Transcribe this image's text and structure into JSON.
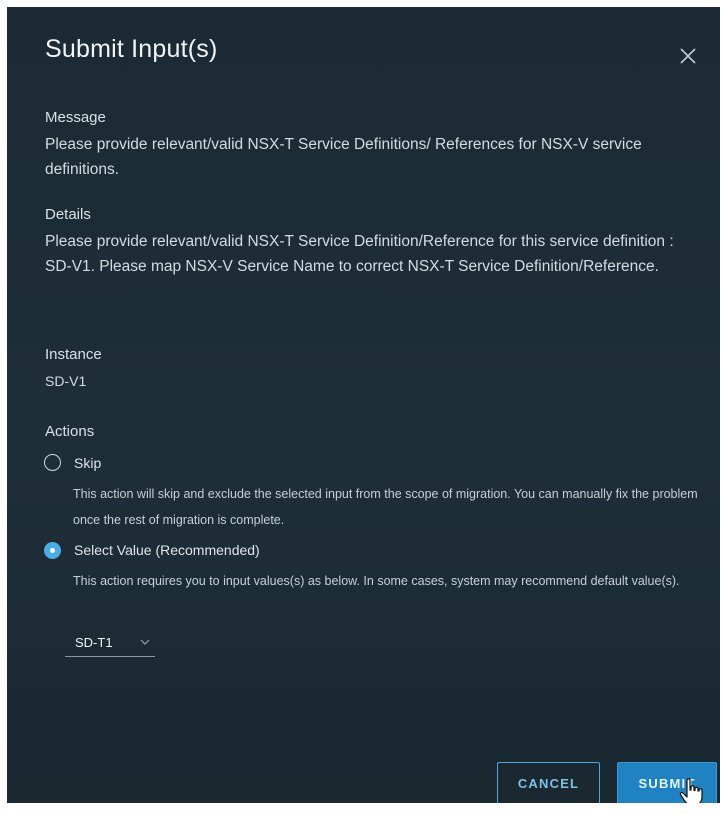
{
  "dialog": {
    "title": "Submit Input(s)",
    "close_icon": "close-icon"
  },
  "message": {
    "label": "Message",
    "text": "Please provide relevant/valid NSX-T Service Definitions/ References for NSX-V service definitions."
  },
  "details": {
    "label": "Details",
    "text": "Please provide relevant/valid NSX-T Service Definition/Reference for this service definition : SD-V1. Please map NSX-V Service Name to correct NSX-T Service Definition/Reference."
  },
  "instance": {
    "label": "Instance",
    "value": "SD-V1"
  },
  "actions": {
    "label": "Actions",
    "options": [
      {
        "label": "Skip",
        "selected": false,
        "description": "This action will skip and exclude the selected input from the scope of migration. You can manually fix the problem once the rest of migration is complete."
      },
      {
        "label": "Select Value (Recommended)",
        "selected": true,
        "description": "This action requires you to input values(s) as below. In some cases, system may recommend default value(s)."
      }
    ],
    "select": {
      "value": "SD-T1",
      "caret_icon": "chevron-down-icon"
    }
  },
  "buttons": {
    "cancel": "CANCEL",
    "submit": "SUBMIT"
  },
  "colors": {
    "background": "#1e2e38",
    "accent": "#49aee6",
    "primary_button": "#1f83c3"
  }
}
